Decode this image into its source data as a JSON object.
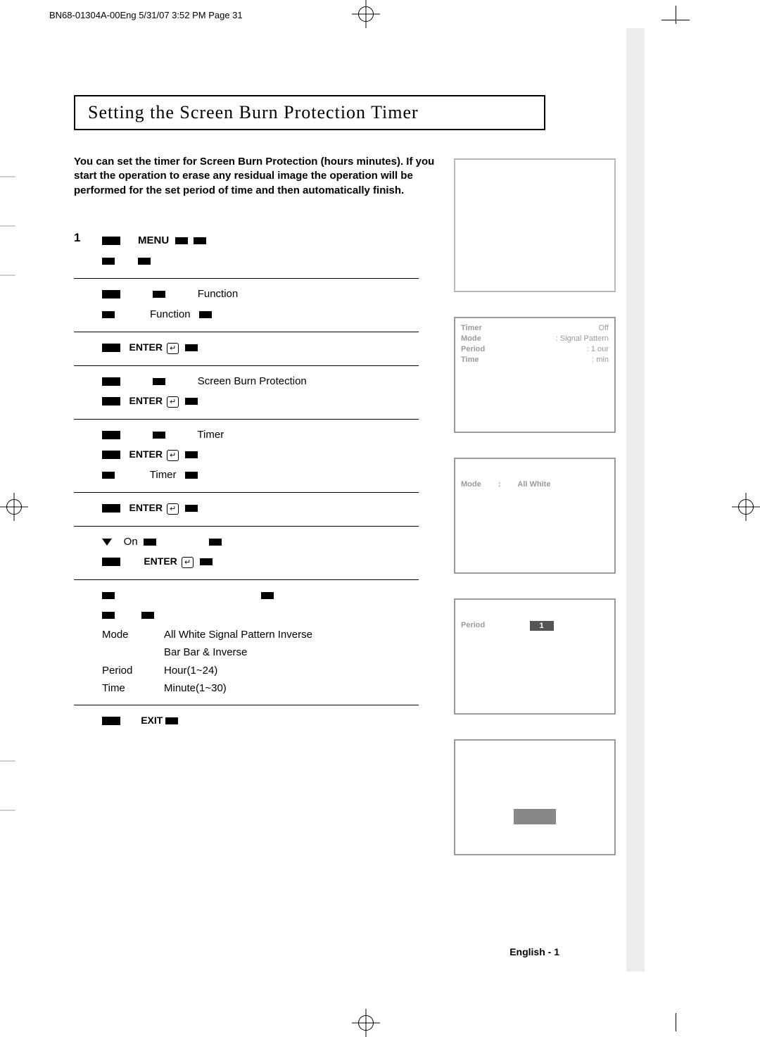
{
  "header_print": "BN68-01304A-00Eng  5/31/07  3:52 PM  Page 31",
  "title": "Setting the Screen Burn Protection Timer",
  "intro": "You can set the timer for Screen Burn Protection (hours  minutes). If you start the operation to erase any residual image  the operation will be performed for the set period of time and then automatically finish.",
  "steps": {
    "s1_num": "1",
    "s1_menu": "MENU",
    "s2_function": "Function",
    "s2_function2": "Function",
    "s3_enter": "ENTER",
    "s4_sbp": "Screen Burn Protection",
    "s4_enter": "ENTER",
    "s5_timer": "Timer",
    "s5_enter": "ENTER",
    "s5_timer2": "Timer",
    "s6_enter": "ENTER",
    "s7_on": "On",
    "s7_enter": "ENTER",
    "s8_mode": "Mode",
    "s8_mode_opts": "All White     Signal Pattern          Inverse",
    "s8_mode_opts2": "Bar    Bar & Inverse",
    "s8_period": "Period",
    "s8_period_v": "Hour(1~24)",
    "s8_time": "Time",
    "s8_time_v": "Minute(1~30)",
    "s9_exit": "EXIT"
  },
  "tv1": {
    "timer_l": "Timer",
    "timer_v": "Off",
    "mode_l": "Mode",
    "mode_v": ": Signal Pattern",
    "period_l": "Period",
    "period_v": ":  1     our",
    "time_l": "Time",
    "time_v": ":       min"
  },
  "tv2": {
    "mode_l": "Mode",
    "mode_colon": ":",
    "mode_v": "All White"
  },
  "tv3": {
    "period_l": "Period",
    "period_v": "1"
  },
  "footer": "English -   1"
}
